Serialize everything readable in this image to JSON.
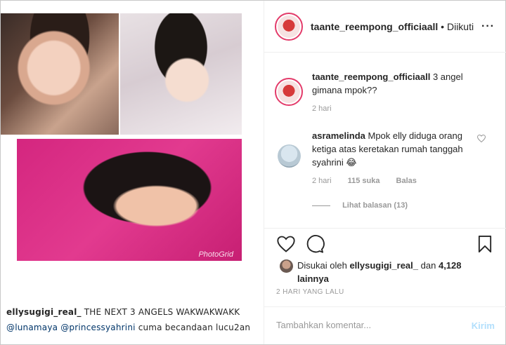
{
  "header": {
    "username": "taante_reempong_officiaall",
    "separator": "•",
    "follow_label": "Diikuti",
    "more_icon": "more-horizontal-icon"
  },
  "post": {
    "watermark": "PhotoGrid",
    "caption_user": "ellysugigi_real_",
    "caption_text": "THE NEXT 3 ANGELS WAKWAKWAKK",
    "caption_mentions": [
      "@lunamaya",
      "@princessyahrini"
    ],
    "caption_rest": "cuma becandaan lucu2an"
  },
  "comments": [
    {
      "user": "taante_reempong_officiaall",
      "text": "3 angel gimana mpok??",
      "time": "2 hari"
    },
    {
      "user": "asramelinda",
      "text": "Mpok elly diduga orang ketiga atas keretakan rumah tanggah syahrini 😂",
      "time": "2 hari",
      "likes": "115 suka",
      "reply_label": "Balas",
      "view_replies": "Lihat balasan (13)"
    }
  ],
  "likes": {
    "prefix": "Disukai oleh",
    "user": "ellysugigi_real_",
    "connector": "dan",
    "count": "4,128 lainnya"
  },
  "date": "2 HARI YANG LALU",
  "add_comment": {
    "placeholder": "Tambahkan komentar...",
    "post_label": "Kirim"
  },
  "colors": {
    "accent": "#e33b6a",
    "link": "#003569",
    "muted": "#999999",
    "post_disabled": "#b2dffc"
  }
}
